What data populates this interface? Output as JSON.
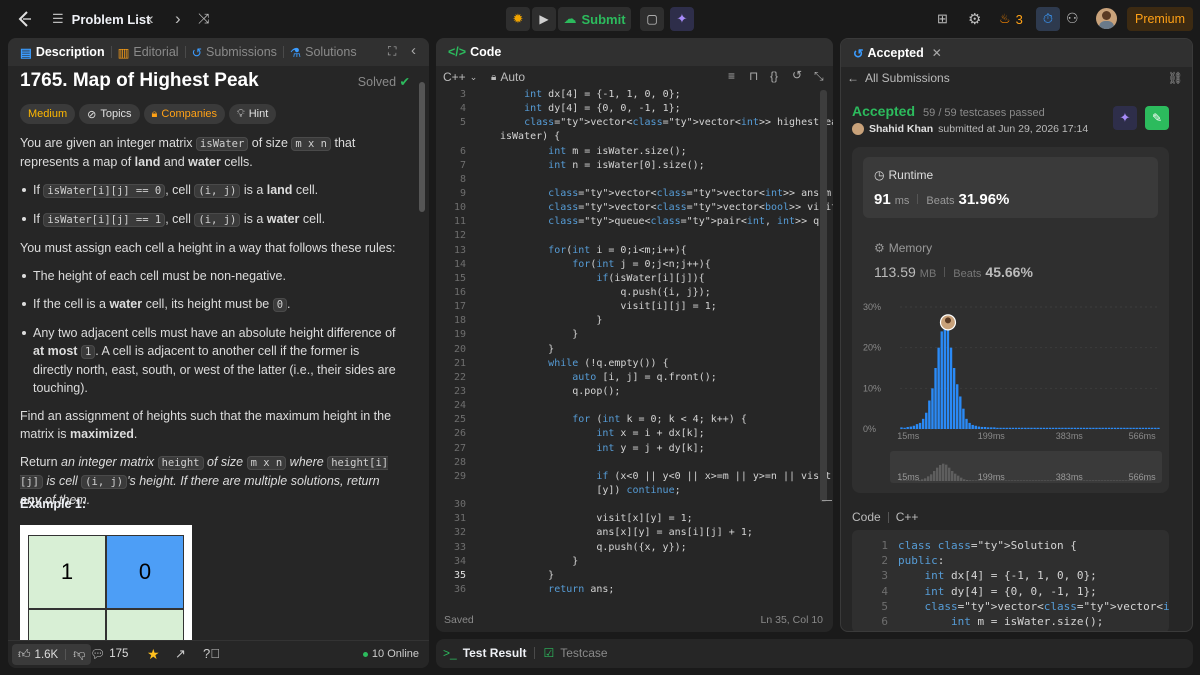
{
  "topbar": {
    "problem_list": "Problem List",
    "submit": "Submit",
    "streak": "3",
    "premium": "Premium"
  },
  "desc": {
    "tabs": [
      "Description",
      "Editorial",
      "Submissions",
      "Solutions"
    ],
    "title": "1765. Map of Highest Peak",
    "solved": "Solved",
    "chips": [
      "Medium",
      "Topics",
      "Companies",
      "Hint"
    ],
    "p1": {
      "a": "You are given an integer matrix ",
      "c1": "isWater",
      "b": " of size ",
      "c2": "m x n",
      "c": " that represents a map of ",
      "d": "land",
      "e": " and ",
      "f": "water",
      "g": " cells."
    },
    "b1": {
      "a": "If ",
      "c": "isWater[i][j] == 0",
      "b": ", cell ",
      "c2": "(i, j)",
      "d": " is a ",
      "e": "land",
      "f": " cell."
    },
    "b2": {
      "a": "If ",
      "c": "isWater[i][j] == 1",
      "b": ", cell ",
      "c2": "(i, j)",
      "d": " is a ",
      "e": "water",
      "f": " cell."
    },
    "p2": "You must assign each cell a height in a way that follows these rules:",
    "r1": "The height of each cell must be non-negative.",
    "r2": {
      "a": "If the cell is a ",
      "b": "water",
      "c": " cell, its height must be ",
      "d": "0",
      "e": "."
    },
    "r3": {
      "a": "Any two adjacent cells must have an absolute height difference of ",
      "b": "at most",
      "c": " ",
      "d": "1",
      "e": ". A cell is adjacent to another cell if the former is directly north, east, south, or west of the latter (i.e., their sides are touching)."
    },
    "p3": {
      "a": "Find an assignment of heights such that the maximum height in the matrix is ",
      "b": "maximized",
      "c": "."
    },
    "p4": {
      "a": "Return ",
      "b": "an integer matrix ",
      "c": "height",
      "d": " of size ",
      "e": "m x n",
      "f": " where ",
      "g": "height[i][j]",
      "h": " is cell ",
      "i": "(i, j)",
      "j": "'s height. If there are multiple solutions, return ",
      "k": "any",
      "l": " of them."
    },
    "example": "Example 1:",
    "grid": [
      "1",
      "0"
    ],
    "likes": "1.6K",
    "comments": "175",
    "online": "10 Online"
  },
  "code": {
    "tab": "Code",
    "lang": "C++",
    "mode": "Auto",
    "lines": [
      {
        "n": "3",
        "t": "    int dx[4] = {-1, 1, 0, 0};"
      },
      {
        "n": "4",
        "t": "    int dy[4] = {0, 0, -1, 1};"
      },
      {
        "n": "5",
        "t": "    vector<vector<int>> highestPeak(vector<vector<int>>&"
      },
      {
        "n": "",
        "t": "isWater) {"
      },
      {
        "n": "6",
        "t": "        int m = isWater.size();"
      },
      {
        "n": "7",
        "t": "        int n = isWater[0].size();"
      },
      {
        "n": "8",
        "t": ""
      },
      {
        "n": "9",
        "t": "        vector<vector<int>> ans(m, vector<int>(n, 0));"
      },
      {
        "n": "10",
        "t": "        vector<vector<bool>> visit(m, vector<bool>(n, 0));"
      },
      {
        "n": "11",
        "t": "        queue<pair<int, int>> q;"
      },
      {
        "n": "12",
        "t": ""
      },
      {
        "n": "13",
        "t": "        for(int i = 0;i<m;i++){"
      },
      {
        "n": "14",
        "t": "            for(int j = 0;j<n;j++){"
      },
      {
        "n": "15",
        "t": "                if(isWater[i][j]){"
      },
      {
        "n": "16",
        "t": "                    q.push({i, j});"
      },
      {
        "n": "17",
        "t": "                    visit[i][j] = 1;"
      },
      {
        "n": "18",
        "t": "                }"
      },
      {
        "n": "19",
        "t": "            }"
      },
      {
        "n": "20",
        "t": "        }"
      },
      {
        "n": "21",
        "t": "        while (!q.empty()) {"
      },
      {
        "n": "22",
        "t": "            auto [i, j] = q.front();"
      },
      {
        "n": "23",
        "t": "            q.pop();"
      },
      {
        "n": "24",
        "t": ""
      },
      {
        "n": "25",
        "t": "            for (int k = 0; k < 4; k++) {"
      },
      {
        "n": "26",
        "t": "                int x = i + dx[k];"
      },
      {
        "n": "27",
        "t": "                int y = j + dy[k];"
      },
      {
        "n": "28",
        "t": ""
      },
      {
        "n": "29",
        "t": "                if (x<0 || y<0 || x>=m || y>=n || visit[x]"
      },
      {
        "n": "",
        "t": "                [y]) continue;"
      },
      {
        "n": "30",
        "t": ""
      },
      {
        "n": "31",
        "t": "                visit[x][y] = 1;"
      },
      {
        "n": "32",
        "t": "                ans[x][y] = ans[i][j] + 1;"
      },
      {
        "n": "33",
        "t": "                q.push({x, y});"
      },
      {
        "n": "34",
        "t": "            }"
      },
      {
        "n": "35",
        "t": "        }"
      },
      {
        "n": "36",
        "t": "        return ans;"
      }
    ],
    "status": "Saved",
    "position": "Ln 35, Col 10"
  },
  "acc": {
    "tab": "Accepted",
    "all": "All Submissions",
    "status": "Accepted",
    "passed": "59 / 59 testcases passed",
    "user": "Shahid Khan",
    "submitted": "submitted at Jun 29, 2026 17:14",
    "runtime_label": "Runtime",
    "runtime_value": "91",
    "runtime_unit": "ms",
    "beats_label": "Beats",
    "runtime_beats": "31.96%",
    "memory_label": "Memory",
    "memory_value": "113.59",
    "memory_unit": "MB",
    "memory_beats": "45.66%",
    "code_label": "Code",
    "code_lang": "C++",
    "snippet": [
      {
        "n": "1",
        "t": "class Solution {"
      },
      {
        "n": "2",
        "t": "public:"
      },
      {
        "n": "3",
        "t": "    int dx[4] = {-1, 1, 0, 0};"
      },
      {
        "n": "4",
        "t": "    int dy[4] = {0, 0, -1, 1};"
      },
      {
        "n": "5",
        "t": "    vector<vector<int>> highestPeak(vector<"
      },
      {
        "n": "6",
        "t": "        int m = isWater.size();"
      }
    ]
  },
  "chart_data": {
    "type": "bar",
    "y_ticks": [
      "30%",
      "20%",
      "10%",
      "0%"
    ],
    "x_ticks": [
      "15ms",
      "199ms",
      "383ms",
      "566ms"
    ],
    "ylim": [
      0,
      30
    ],
    "accent": "#2a8af6",
    "highlight_bin": 15,
    "values": [
      0.4,
      0.3,
      0.5,
      0.6,
      0.8,
      1.2,
      1.5,
      2.5,
      4.0,
      7.0,
      10.0,
      15.0,
      20.0,
      24.0,
      26.0,
      24.5,
      20.0,
      15.0,
      11.0,
      8.0,
      5.0,
      2.5,
      1.5,
      1.0,
      0.8,
      0.6,
      0.5,
      0.5,
      0.4,
      0.4,
      0.4,
      0.3,
      0.3,
      0.3,
      0.3,
      0.3,
      0.3,
      0.3,
      0.3,
      0.3,
      0.3,
      0.3,
      0.3,
      0.3,
      0.3,
      0.3,
      0.3,
      0.3,
      0.3,
      0.3,
      0.3,
      0.3,
      0.3,
      0.3,
      0.3,
      0.3,
      0.3,
      0.3,
      0.3,
      0.3,
      0.3,
      0.3,
      0.3,
      0.3,
      0.3,
      0.3,
      0.3,
      0.3,
      0.3,
      0.3,
      0.3,
      0.3,
      0.3,
      0.3,
      0.3,
      0.3,
      0.3,
      0.3,
      0.3,
      0.3,
      0.3,
      0.3,
      0.3,
      0.3
    ]
  },
  "test": {
    "result": "Test Result",
    "testcase": "Testcase"
  }
}
